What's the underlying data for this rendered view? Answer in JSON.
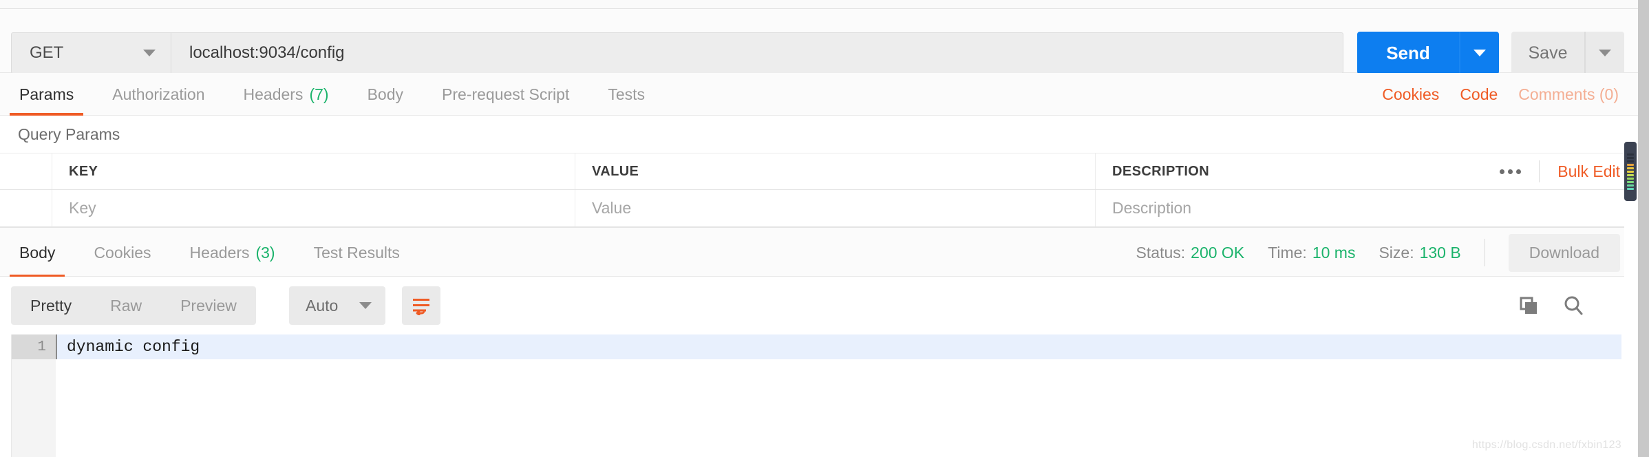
{
  "request": {
    "method": "GET",
    "url": "localhost:9034/config",
    "send_label": "Send",
    "save_label": "Save",
    "tabs": [
      {
        "label": "Params",
        "count": "",
        "active": true
      },
      {
        "label": "Authorization",
        "count": "",
        "active": false
      },
      {
        "label": "Headers",
        "count": "(7)",
        "active": false
      },
      {
        "label": "Body",
        "count": "",
        "active": false
      },
      {
        "label": "Pre-request Script",
        "count": "",
        "active": false
      },
      {
        "label": "Tests",
        "count": "",
        "active": false
      }
    ],
    "right_links": [
      {
        "label": "Cookies",
        "dim": false
      },
      {
        "label": "Code",
        "dim": false
      },
      {
        "label": "Comments (0)",
        "dim": true
      }
    ]
  },
  "query_params": {
    "title": "Query Params",
    "columns": [
      "KEY",
      "VALUE",
      "DESCRIPTION"
    ],
    "rows": [
      {
        "key": "Key",
        "value": "Value",
        "description": "Description"
      }
    ],
    "bulk_edit_label": "Bulk Edit",
    "more_icon": "ellipsis-icon"
  },
  "response": {
    "tabs": [
      {
        "label": "Body",
        "count": "",
        "active": true
      },
      {
        "label": "Cookies",
        "count": "",
        "active": false
      },
      {
        "label": "Headers",
        "count": "(3)",
        "active": false
      },
      {
        "label": "Test Results",
        "count": "",
        "active": false
      }
    ],
    "status_label": "Status:",
    "status_value": "200 OK",
    "time_label": "Time:",
    "time_value": "10 ms",
    "size_label": "Size:",
    "size_value": "130 B",
    "download_label": "Download",
    "view_modes": [
      {
        "label": "Pretty",
        "active": true
      },
      {
        "label": "Raw",
        "active": false
      },
      {
        "label": "Preview",
        "active": false
      }
    ],
    "format": "Auto",
    "wrap_icon": "wrap-lines-icon",
    "copy_icon": "copy-icon",
    "search_icon": "search-icon",
    "body": {
      "lines": [
        {
          "number": "1",
          "text": "dynamic config"
        }
      ]
    }
  },
  "watermark": "https://blog.csdn.net/fxbin123",
  "colors": {
    "accent_orange": "#ef5b25",
    "send_blue": "#0d7ef0",
    "status_green": "#1bb36b"
  }
}
